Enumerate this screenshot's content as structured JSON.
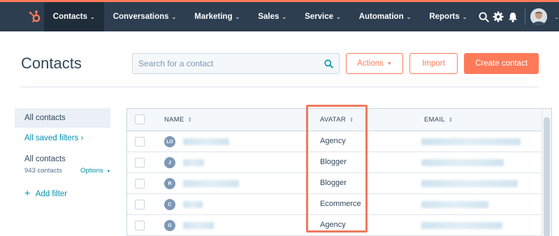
{
  "nav": {
    "items": [
      {
        "label": "Contacts",
        "active": true
      },
      {
        "label": "Conversations",
        "active": false
      },
      {
        "label": "Marketing",
        "active": false
      },
      {
        "label": "Sales",
        "active": false
      },
      {
        "label": "Service",
        "active": false
      },
      {
        "label": "Automation",
        "active": false
      },
      {
        "label": "Reports",
        "active": false
      }
    ],
    "icons": [
      "search-icon",
      "gear-icon",
      "bell-icon"
    ]
  },
  "header": {
    "title": "Contacts",
    "search_placeholder": "Search for a contact",
    "actions_label": "Actions",
    "import_label": "Import",
    "create_label": "Create contact"
  },
  "sidebar": {
    "all_contacts": "All contacts",
    "saved_filters": "All saved filters",
    "current_view": "All contacts",
    "count": "943 contacts",
    "options": "Options",
    "add_filter": "Add filter"
  },
  "table": {
    "headers": {
      "name": "NAME",
      "avatar": "AVATAR",
      "email": "EMAIL"
    },
    "rows": [
      {
        "initials": "LO",
        "avatar": "Agency"
      },
      {
        "initials": "J",
        "avatar": "Blogger"
      },
      {
        "initials": "R",
        "avatar": "Blogger"
      },
      {
        "initials": "C",
        "avatar": "Ecommerce"
      },
      {
        "initials": "G",
        "avatar": "Agency"
      }
    ]
  },
  "colors": {
    "nav_bg": "#2d3e50",
    "accent": "#ff7a59",
    "link": "#0091ae",
    "highlight": "#f07a5e"
  }
}
